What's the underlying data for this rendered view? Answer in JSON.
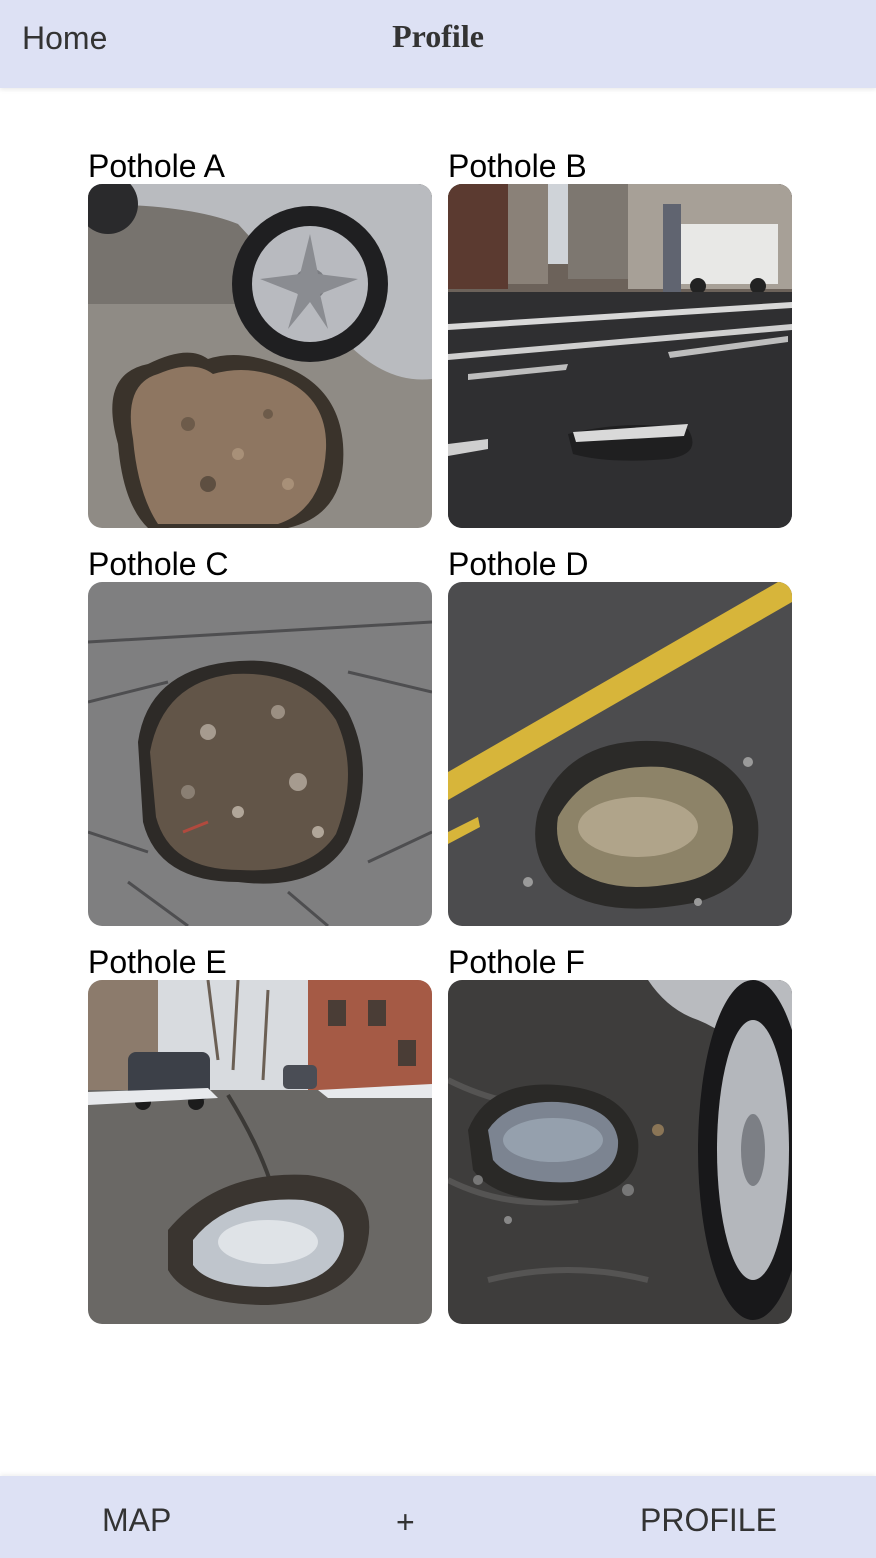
{
  "header": {
    "home_label": "Home",
    "title": "Profile",
    "background": "#dde1f4"
  },
  "potholes": [
    {
      "label": "Pothole A",
      "photo": "pothole-next-to-silver-car-wheel"
    },
    {
      "label": "Pothole B",
      "photo": "pothole-on-city-street-crosswalk"
    },
    {
      "label": "Pothole C",
      "photo": "cracked-asphalt-pothole-with-gravel"
    },
    {
      "label": "Pothole D",
      "photo": "water-filled-pothole-by-yellow-line"
    },
    {
      "label": "Pothole E",
      "photo": "puddle-pothole-on-residential-street"
    },
    {
      "label": "Pothole F",
      "photo": "wet-pothole-beside-car-tire"
    }
  ],
  "bottom_nav": {
    "map_label": "MAP",
    "add_label": "+",
    "profile_label": "PROFILE",
    "background": "#dde1f4"
  }
}
